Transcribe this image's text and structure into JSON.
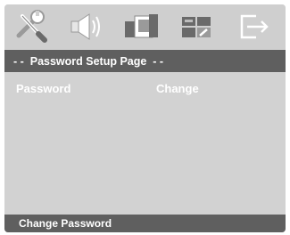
{
  "tabs": [
    {
      "icon": "tools-icon"
    },
    {
      "icon": "speaker-icon"
    },
    {
      "icon": "display-icon"
    },
    {
      "icon": "preferences-icon"
    },
    {
      "icon": "exit-icon"
    }
  ],
  "page_title": "- -  Password Setup Page  - -",
  "rows": [
    {
      "label": "Password",
      "value": "Change"
    }
  ],
  "status_text": "Change Password",
  "colors": {
    "background": "#d2d2d2",
    "bar": "#5f5f5f",
    "text": "#ffffff",
    "icon_light": "#ffffff",
    "icon_mid": "#9a9a9a",
    "icon_dark": "#6a6a6a"
  }
}
